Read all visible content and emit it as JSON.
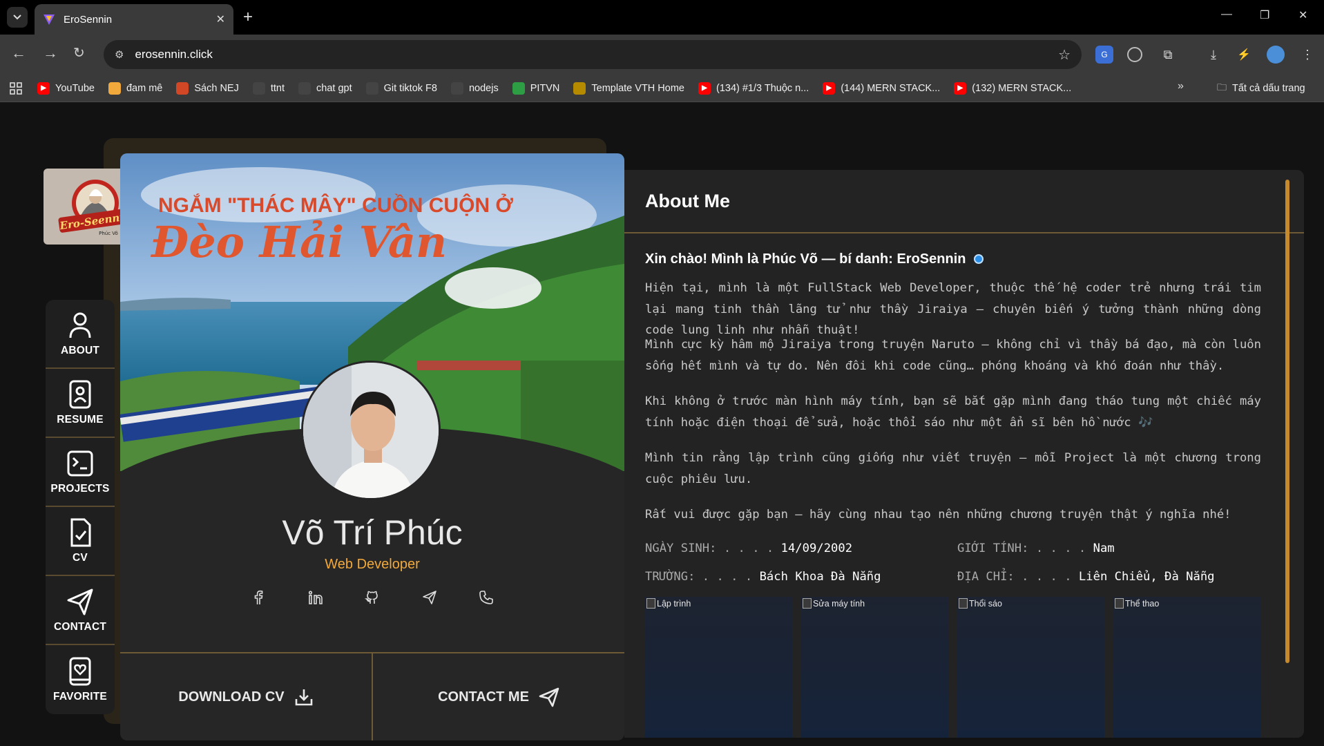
{
  "browser": {
    "tab_title": "EroSennin",
    "url": "erosennin.click",
    "bookmarks": [
      {
        "label": "YouTube",
        "icon": "youtube-icon",
        "color": "#ff0000"
      },
      {
        "label": "đam mê",
        "icon": "j-icon",
        "color": "#f1a93b"
      },
      {
        "label": "Sách NEJ",
        "icon": "powerpoint-icon",
        "color": "#d24726"
      },
      {
        "label": "ttnt",
        "icon": "moon-icon",
        "color": "#444444"
      },
      {
        "label": "chat gpt",
        "icon": "chatgpt-icon",
        "color": "#444444"
      },
      {
        "label": "Git tiktok F8",
        "icon": "github-icon",
        "color": "#444444"
      },
      {
        "label": "nodejs",
        "icon": "github-icon",
        "color": "#444444"
      },
      {
        "label": "PITVN",
        "icon": "cross-icon",
        "color": "#2e9e44"
      },
      {
        "label": "Template VTH Home",
        "icon": "lock-icon",
        "color": "#b58a00"
      },
      {
        "label": "(134) #1/3 Thuộc n...",
        "icon": "youtube-icon",
        "color": "#ff0000"
      },
      {
        "label": "(144) MERN STACK...",
        "icon": "youtube-icon",
        "color": "#ff0000"
      },
      {
        "label": "(132) MERN STACK...",
        "icon": "youtube-icon",
        "color": "#ff0000"
      }
    ],
    "all_bookmarks": "Tất cả dấu trang"
  },
  "sidebar": {
    "items": [
      {
        "label": "ABOUT",
        "icon": "user-icon"
      },
      {
        "label": "RESUME",
        "icon": "resume-icon"
      },
      {
        "label": "PROJECTS",
        "icon": "terminal-icon"
      },
      {
        "label": "CV",
        "icon": "document-check-icon"
      },
      {
        "label": "CONTACT",
        "icon": "send-icon"
      },
      {
        "label": "FAVORITE",
        "icon": "heart-book-icon"
      }
    ]
  },
  "profile": {
    "banner_line1": "NGẮM \"THÁC MÂY\" CUỒN CUỘN Ở",
    "banner_line2": "Đèo Hải Vân",
    "logo_text": "Ero-Seennin",
    "logo_sub": "Phúc Võ",
    "name": "Võ Trí Phúc",
    "role": "Web Developer",
    "socials": [
      "facebook-icon",
      "linkedin-icon",
      "github-icon",
      "telegram-icon",
      "phone-icon"
    ],
    "download_cv": "DOWNLOAD CV",
    "contact_me": "CONTACT ME"
  },
  "about": {
    "heading": "About Me",
    "greeting": "Xin chào! Mình là Phúc Võ — bí danh: EroSennin",
    "paragraphs": [
      "Hiện tại, mình là một FullStack Web Developer, thuộc thế hệ coder trẻ nhưng trái tim lại mang tinh thần lãng tử như thầy Jiraiya — chuyên biến ý tưởng thành những dòng code lung linh như nhẫn thuật!",
      "Mình cực kỳ hâm mộ Jiraiya trong truyện Naruto — không chỉ vì thầy bá đạo, mà còn luôn sống hết mình và tự do. Nên đôi khi code cũng… phóng khoáng và khó đoán như thầy.",
      "Khi không ở trước màn hình máy tính, bạn sẽ bắt gặp mình đang tháo tung một chiếc máy tính hoặc điện thoại để sửa, hoặc thổi sáo như một ẩn sĩ bên hồ nước 🎶",
      "Mình tin rằng lập trình cũng giống như viết truyện — mỗi Project là một chương trong cuộc phiêu lưu.",
      "Rất vui được gặp bạn — hãy cùng nhau tạo nên những chương truyện thật ý nghĩa nhé!"
    ],
    "info": {
      "dob_label": "NGÀY SINH: . . . . ",
      "dob_value": "14/09/2002",
      "gender_label": "GIỚI TÍNH: . . . . ",
      "gender_value": "Nam",
      "school_label": "TRƯỜNG: . . . . ",
      "school_value": "Bách Khoa Đà Nẵng",
      "address_label": "ĐỊA CHỈ: . . . . ",
      "address_value": "Liên Chiểu, Đà Nẵng"
    },
    "hobbies": [
      "Lập trình",
      "Sửa máy tính",
      "Thổi sáo",
      "Thể thao"
    ]
  },
  "colors": {
    "accent": "#f1a93b",
    "divider": "#6e5a34",
    "panel": "#232323",
    "page_bg": "#121212"
  }
}
